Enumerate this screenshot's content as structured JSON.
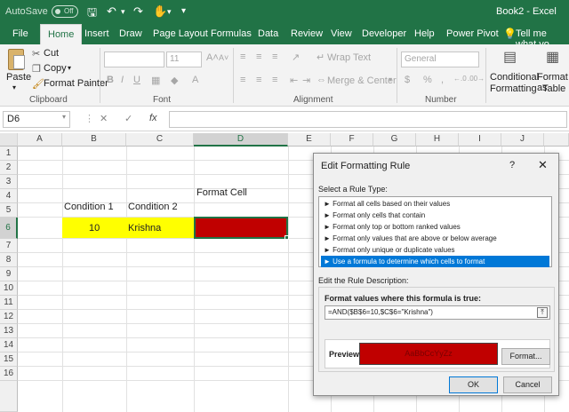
{
  "titlebar": {
    "autosave_label": "AutoSave",
    "autosave_state": "Off",
    "document_title": "Book2 - Excel"
  },
  "ribbon_tabs": [
    "File",
    "Home",
    "Insert",
    "Draw",
    "Page Layout",
    "Formulas",
    "Data",
    "Review",
    "View",
    "Developer",
    "Help",
    "Power Pivot",
    "Tell me what yo"
  ],
  "ribbon": {
    "clipboard": {
      "paste": "Paste",
      "cut": "Cut",
      "copy": "Copy",
      "format_painter": "Format Painter",
      "label": "Clipboard"
    },
    "font": {
      "size": "11",
      "label": "Font",
      "bold": "B",
      "italic": "I",
      "underline": "U"
    },
    "alignment": {
      "wrap_text": "Wrap Text",
      "merge_center": "Merge & Center",
      "label": "Alignment"
    },
    "number": {
      "format": "General",
      "currency": "$",
      "percent": "%",
      "comma": ",",
      "label": "Number"
    },
    "styles": {
      "conditional_1": "Conditional",
      "conditional_2": "Formatting",
      "format_as_1": "Format as",
      "format_as_2": "Table"
    }
  },
  "formula_bar": {
    "name_box": "D6",
    "cancel": "✕",
    "enter": "✓",
    "fx": "fx",
    "content": ""
  },
  "grid": {
    "columns": [
      "A",
      "B",
      "C",
      "D",
      "E",
      "F",
      "G",
      "H",
      "I",
      "J"
    ],
    "rows": [
      "1",
      "2",
      "3",
      "4",
      "5",
      "6",
      "7",
      "8",
      "9",
      "10",
      "11",
      "12",
      "13",
      "14",
      "15",
      "16"
    ],
    "selected_cell": "D6",
    "cells": {
      "d4": "Format Cell",
      "b5": "Condition 1",
      "c5": "Condition 2",
      "b6": "10",
      "c6": "Krishna"
    },
    "colors": {
      "highlight_yellow": "#ffff00",
      "format_fill": "#c00000"
    }
  },
  "dialog": {
    "title": "Edit Formatting Rule",
    "help": "?",
    "close": "✕",
    "select_rule_label": "Select a Rule Type:",
    "rule_types": [
      "► Format all cells based on their values",
      "► Format only cells that contain",
      "► Format only top or bottom ranked values",
      "► Format only values that are above or below average",
      "► Format only unique or duplicate values",
      "► Use a formula to determine which cells to format"
    ],
    "selected_rule_index": 5,
    "edit_desc_label": "Edit the Rule Description:",
    "formula_heading": "Format values where this formula is true:",
    "formula_value": "=AND($B$6=10,$C$6=\"Krishna\")",
    "preview_label": "Preview:",
    "preview_text": "AaBbCcYyZz",
    "format_button": "Format...",
    "ok_button": "OK",
    "cancel_button": "Cancel"
  }
}
